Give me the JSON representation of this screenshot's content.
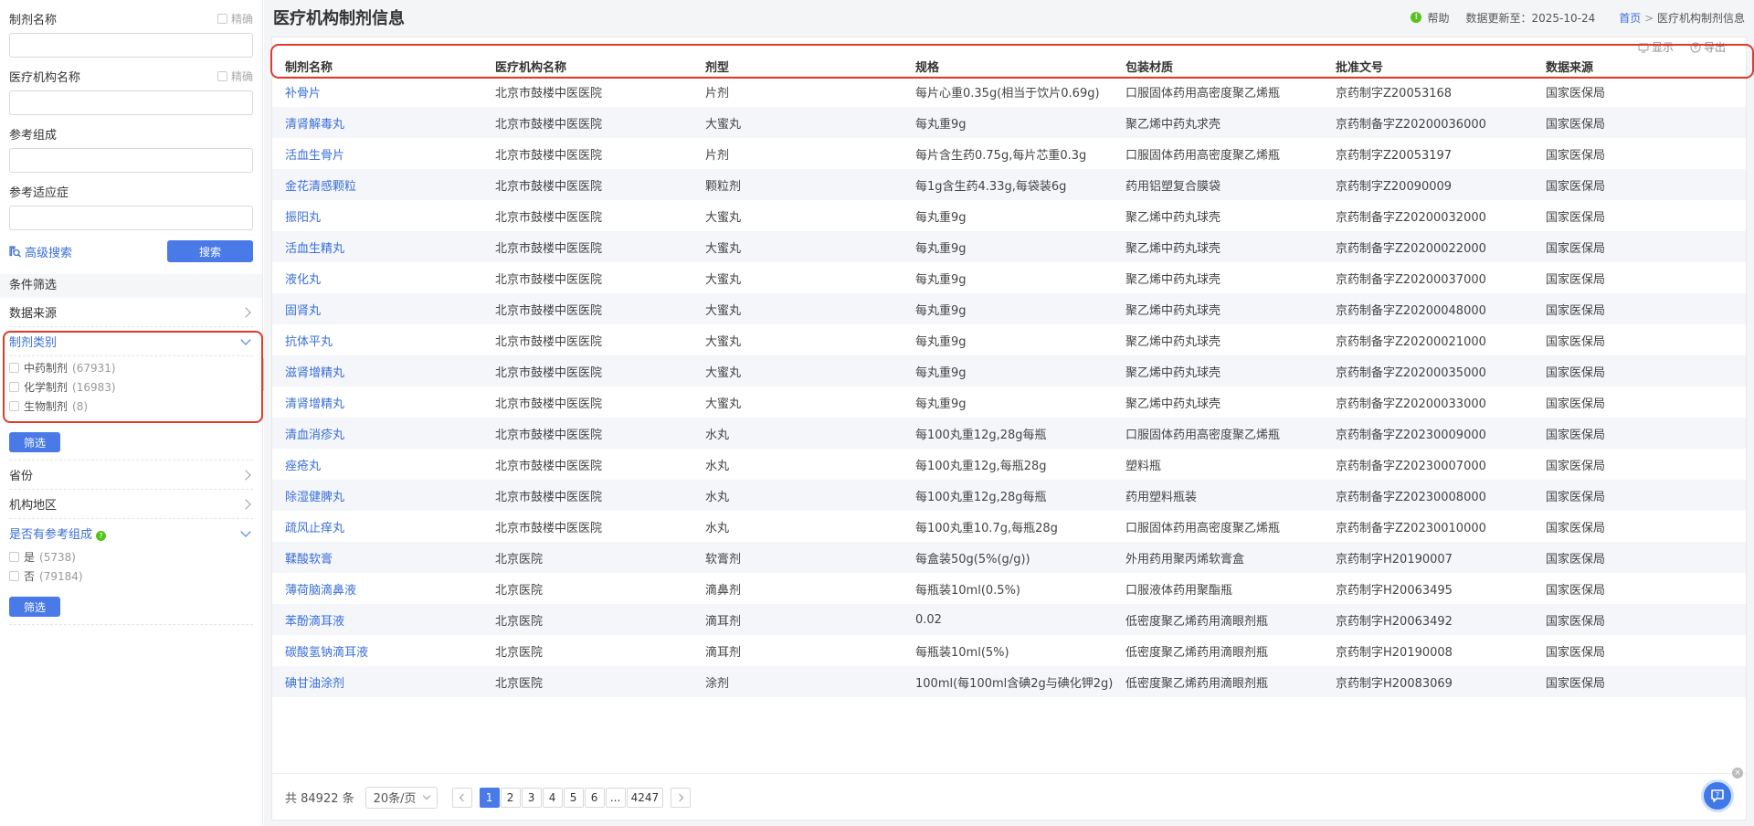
{
  "sidebar": {
    "fields": [
      {
        "label": "制剂名称",
        "exact": "精确",
        "value": ""
      },
      {
        "label": "医疗机构名称",
        "exact": "精确",
        "value": ""
      },
      {
        "label": "参考组成",
        "value": ""
      },
      {
        "label": "参考适应症",
        "value": ""
      }
    ],
    "advanced_search": "高级搜索",
    "search_button": "搜索",
    "conditions_title": "条件筛选",
    "filters": {
      "source": {
        "label": "数据来源"
      },
      "category": {
        "label": "制剂类别",
        "options": [
          {
            "name": "中药制剂",
            "count": "(67931)"
          },
          {
            "name": "化学制剂",
            "count": "(16983)"
          },
          {
            "name": "生物制剂",
            "count": "(8)"
          }
        ],
        "button": "筛选"
      },
      "province": {
        "label": "省份"
      },
      "region": {
        "label": "机构地区"
      },
      "has_ref": {
        "label": "是否有参考组成",
        "help_icon": "?",
        "options": [
          {
            "name": "是",
            "count": "(5738)"
          },
          {
            "name": "否",
            "count": "(79184)"
          }
        ],
        "button": "筛选"
      }
    }
  },
  "header": {
    "title": "医疗机构制剂信息",
    "help_icon": "!",
    "help": "帮助",
    "updated": "数据更新至：2025-10-24",
    "breadcrumb_home": "首页",
    "breadcrumb_sep": ">",
    "breadcrumb_current": "医疗机构制剂信息"
  },
  "toolbar": {
    "show": "显示",
    "export": "导出"
  },
  "table": {
    "columns": [
      "制剂名称",
      "医疗机构名称",
      "剂型",
      "规格",
      "包装材质",
      "批准文号",
      "数据来源"
    ],
    "rows": [
      [
        "补骨片",
        "北京市鼓楼中医医院",
        "片剂",
        "每片心重0.35g(相当于饮片0.69g)",
        "口服固体药用高密度聚乙烯瓶",
        "京药制字Z20053168",
        "国家医保局"
      ],
      [
        "清肾解毒丸",
        "北京市鼓楼中医医院",
        "大蜜丸",
        "每丸重9g",
        "聚乙烯中药丸求壳",
        "京药制备字Z20200036000",
        "国家医保局"
      ],
      [
        "活血生骨片",
        "北京市鼓楼中医医院",
        "片剂",
        "每片含生药0.75g,每片芯重0.3g",
        "口服固体药用高密度聚乙烯瓶",
        "京药制字Z20053197",
        "国家医保局"
      ],
      [
        "金花清感颗粒",
        "北京市鼓楼中医医院",
        "颗粒剂",
        "每1g含生药4.33g,每袋装6g",
        "药用铝塑复合膜袋",
        "京药制字Z20090009",
        "国家医保局"
      ],
      [
        "振阳丸",
        "北京市鼓楼中医医院",
        "大蜜丸",
        "每丸重9g",
        "聚乙烯中药丸球壳",
        "京药制备字Z20200032000",
        "国家医保局"
      ],
      [
        "活血生精丸",
        "北京市鼓楼中医医院",
        "大蜜丸",
        "每丸重9g",
        "聚乙烯中药丸球壳",
        "京药制备字Z20200022000",
        "国家医保局"
      ],
      [
        "液化丸",
        "北京市鼓楼中医医院",
        "大蜜丸",
        "每丸重9g",
        "聚乙烯中药丸球壳",
        "京药制备字Z20200037000",
        "国家医保局"
      ],
      [
        "固肾丸",
        "北京市鼓楼中医医院",
        "大蜜丸",
        "每丸重9g",
        "聚乙烯中药丸球壳",
        "京药制备字Z20200048000",
        "国家医保局"
      ],
      [
        "抗体平丸",
        "北京市鼓楼中医医院",
        "大蜜丸",
        "每丸重9g",
        "聚乙烯中药丸球壳",
        "京药制备字Z20200021000",
        "国家医保局"
      ],
      [
        "滋肾增精丸",
        "北京市鼓楼中医医院",
        "大蜜丸",
        "每丸重9g",
        "聚乙烯中药丸球壳",
        "京药制备字Z20200035000",
        "国家医保局"
      ],
      [
        "清肾增精丸",
        "北京市鼓楼中医医院",
        "大蜜丸",
        "每丸重9g",
        "聚乙烯中药丸球壳",
        "京药制备字Z20200033000",
        "国家医保局"
      ],
      [
        "清血消疹丸",
        "北京市鼓楼中医医院",
        "水丸",
        "每100丸重12g,28g每瓶",
        "口服固体药用高密度聚乙烯瓶",
        "京药制备字Z20230009000",
        "国家医保局"
      ],
      [
        "痤疮丸",
        "北京市鼓楼中医医院",
        "水丸",
        "每100丸重12g,每瓶28g",
        "塑料瓶",
        "京药制备字Z20230007000",
        "国家医保局"
      ],
      [
        "除湿健脾丸",
        "北京市鼓楼中医医院",
        "水丸",
        "每100丸重12g,28g每瓶",
        "药用塑料瓶装",
        "京药制备字Z20230008000",
        "国家医保局"
      ],
      [
        "疏风止痒丸",
        "北京市鼓楼中医医院",
        "水丸",
        "每100丸重10.7g,每瓶28g",
        "口服固体药用高密度聚乙烯瓶",
        "京药制备字Z20230010000",
        "国家医保局"
      ],
      [
        "鞣酸软膏",
        "北京医院",
        "软膏剂",
        "每盒装50g(5%(g/g))",
        "外用药用聚丙烯软膏盒",
        "京药制字H20190007",
        "国家医保局"
      ],
      [
        "薄荷脑滴鼻液",
        "北京医院",
        "滴鼻剂",
        "每瓶装10ml(0.5%)",
        "口服液体药用聚酯瓶",
        "京药制字H20063495",
        "国家医保局"
      ],
      [
        "苯酚滴耳液",
        "北京医院",
        "滴耳剂",
        "0.02",
        "低密度聚乙烯药用滴眼剂瓶",
        "京药制字H20063492",
        "国家医保局"
      ],
      [
        "碳酸氢钠滴耳液",
        "北京医院",
        "滴耳剂",
        "每瓶装10ml(5%)",
        "低密度聚乙烯药用滴眼剂瓶",
        "京药制字H20190008",
        "国家医保局"
      ],
      [
        "碘甘油涂剂",
        "北京医院",
        "涂剂",
        "100ml(每100ml含碘2g与碘化钾2g)",
        "低密度聚乙烯药用滴眼剂瓶",
        "京药制字H20083069",
        "国家医保局"
      ]
    ]
  },
  "pagination": {
    "total": "共 84922 条",
    "page_size": "20条/页",
    "pages": [
      "1",
      "2",
      "3",
      "4",
      "5",
      "6",
      "...",
      "4247"
    ],
    "current": "1"
  },
  "floating": {
    "close_icon": "×"
  },
  "colors": {
    "accent": "#4a7ae8",
    "link": "#3a6fd8",
    "highlight": "#e03a2b"
  }
}
